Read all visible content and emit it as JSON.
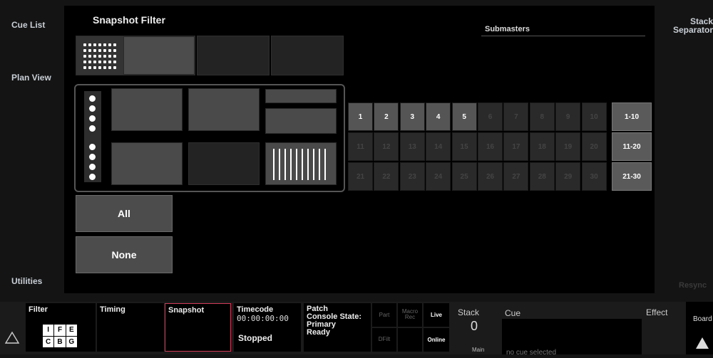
{
  "sidebar": {
    "cue_list": "Cue List",
    "plan_view": "Plan View",
    "utilities": "Utilities"
  },
  "right_sidebar": {
    "stack_separator": "Stack Separator",
    "resync": "Resync"
  },
  "main": {
    "title": "Snapshot Filter",
    "submasters_label": "Submasters",
    "all_button": "All",
    "none_button": "None",
    "submasters": {
      "rows": [
        [
          "1",
          "2",
          "3",
          "4",
          "5",
          "6",
          "7",
          "8",
          "9",
          "10"
        ],
        [
          "11",
          "12",
          "13",
          "14",
          "15",
          "16",
          "17",
          "18",
          "19",
          "20"
        ],
        [
          "21",
          "22",
          "23",
          "24",
          "25",
          "26",
          "27",
          "28",
          "29",
          "30"
        ]
      ],
      "active": [
        "1",
        "2",
        "3",
        "4",
        "5"
      ],
      "ranges": [
        "1-10",
        "11-20",
        "21-30"
      ]
    }
  },
  "bottom": {
    "filter_label": "Filter",
    "filter_letters": [
      "I",
      "F",
      "E",
      "C",
      "B",
      "G"
    ],
    "timing_label": "Timing",
    "snapshot_label": "Snapshot",
    "timecode_label": "Timecode",
    "timecode_value": "00:00:00:00",
    "timecode_status": "Stopped",
    "patch_label": "Patch",
    "console_state_label": "Console State:",
    "console_state_value": "Primary Ready",
    "part_label": "Part",
    "macro_rec_label": "Macro Rec",
    "live_label": "Live",
    "dfilt_label": "DFilt",
    "online_label": "Online",
    "stack_label": "Stack",
    "stack_value": "0",
    "main_label": "Main",
    "cue_label": "Cue",
    "cue_status": "no cue selected",
    "effect_label": "Effect",
    "board_label": "Board"
  },
  "colors": {
    "highlight": "#d03a57"
  }
}
